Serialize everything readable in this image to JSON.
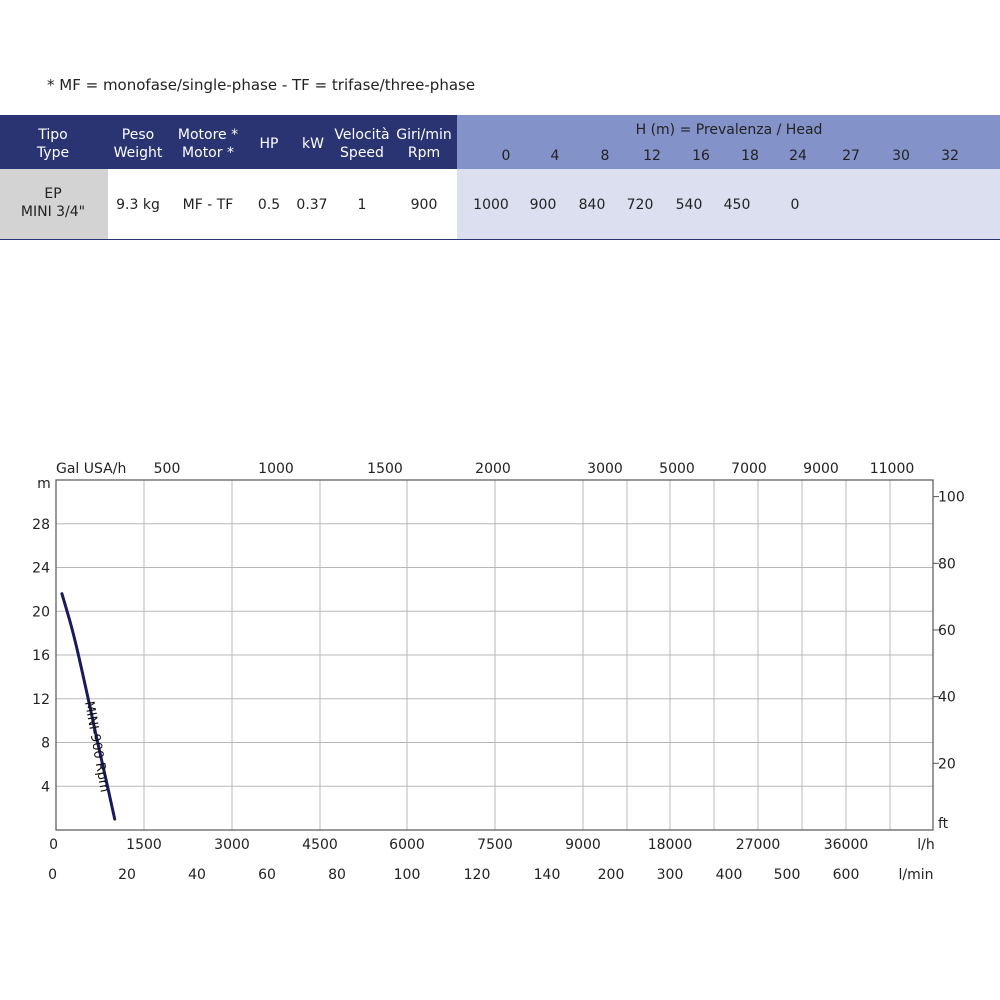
{
  "note": "* MF = monofase/single-phase - TF = trifase/three-phase",
  "table": {
    "headers": [
      {
        "l1": "Tipo",
        "l2": "Type"
      },
      {
        "l1": "Peso",
        "l2": "Weight"
      },
      {
        "l1": "Motore *",
        "l2": "Motor *"
      },
      {
        "l1": "HP",
        "l2": ""
      },
      {
        "l1": "kW",
        "l2": ""
      },
      {
        "l1": "Velocità",
        "l2": "Speed"
      },
      {
        "l1": "Giri/min",
        "l2": "Rpm"
      }
    ],
    "head_title": "H (m) = Prevalenza /  Head",
    "head_values": [
      "0",
      "4",
      "8",
      "12",
      "16",
      "18",
      "24",
      "27",
      "30",
      "32"
    ],
    "row": {
      "type_l1": "EP",
      "type_l2": "MINI 3/4\"",
      "weight": "9.3 kg",
      "motor": "MF - TF",
      "hp": "0.5",
      "kw": "0.37",
      "speed": "1",
      "rpm": "900",
      "flows": [
        "1000",
        "900",
        "840",
        "720",
        "540",
        "450",
        "0",
        "",
        "",
        ""
      ]
    }
  },
  "chart_data": {
    "type": "line",
    "ylabel": "m",
    "y_ticks": [
      "4",
      "8",
      "12",
      "16",
      "20",
      "24",
      "28"
    ],
    "ylim": [
      0,
      32
    ],
    "ylabel_right": "ft",
    "y2_ticks": [
      "20",
      "40",
      "60",
      "80",
      "100"
    ],
    "top_axis_label": "Gal USA/h",
    "top_ticks": [
      "500",
      "1000",
      "1500",
      "2000",
      "3000",
      "5000",
      "7000",
      "9000",
      "11000"
    ],
    "x_lh_label": "l/h",
    "x_lh_ticks": [
      "0",
      "1500",
      "3000",
      "4500",
      "6000",
      "7500",
      "9000",
      "18000",
      "27000",
      "36000"
    ],
    "x_lmin_label": "l/min",
    "x_lmin_ticks": [
      "0",
      "20",
      "40",
      "60",
      "80",
      "100",
      "120",
      "140",
      "200",
      "300",
      "400",
      "500",
      "600"
    ],
    "grid": true,
    "series": [
      {
        "name": "MINI-900 Rpm",
        "color": "#1a1a5e",
        "x_lh": [
          100,
          300,
          550,
          750,
          880,
          1000
        ],
        "y_m": [
          21.6,
          18,
          12,
          7,
          4,
          1
        ]
      }
    ]
  }
}
